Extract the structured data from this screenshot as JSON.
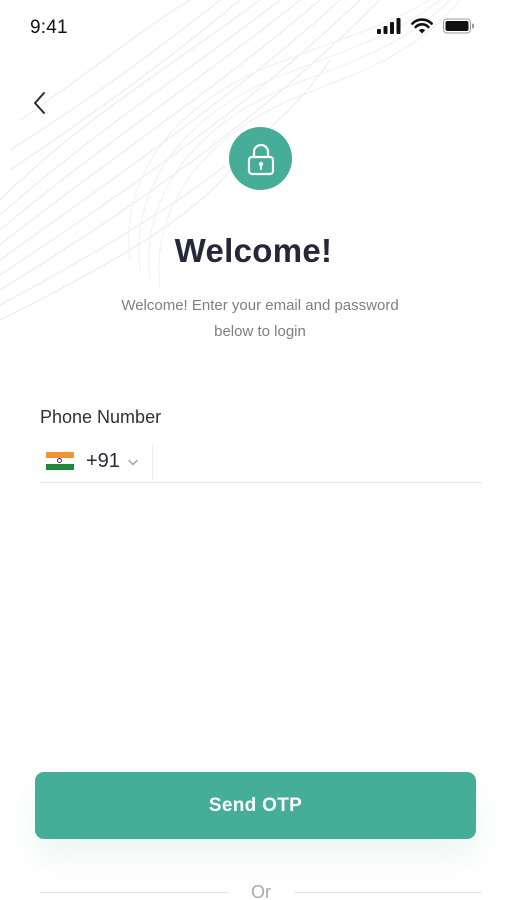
{
  "status_bar": {
    "time": "9:41",
    "icons": [
      "cellular-signal-icon",
      "wifi-icon",
      "battery-icon"
    ]
  },
  "nav": {
    "back_icon": "chevron-left-icon"
  },
  "header": {
    "lock_icon": "lock-icon",
    "title": "Welcome!",
    "subtitle_line1": "Welcome! Enter your email and password",
    "subtitle_line2": "below to login"
  },
  "form": {
    "phone_label": "Phone Number",
    "country": {
      "flag": "india-flag-icon",
      "code": "+91"
    },
    "phone_value": "",
    "phone_placeholder": ""
  },
  "actions": {
    "send_otp_label": "Send OTP",
    "or_label": "Or"
  },
  "colors": {
    "accent": "#46ad98",
    "title": "#27273b",
    "muted": "#7d7d86"
  }
}
